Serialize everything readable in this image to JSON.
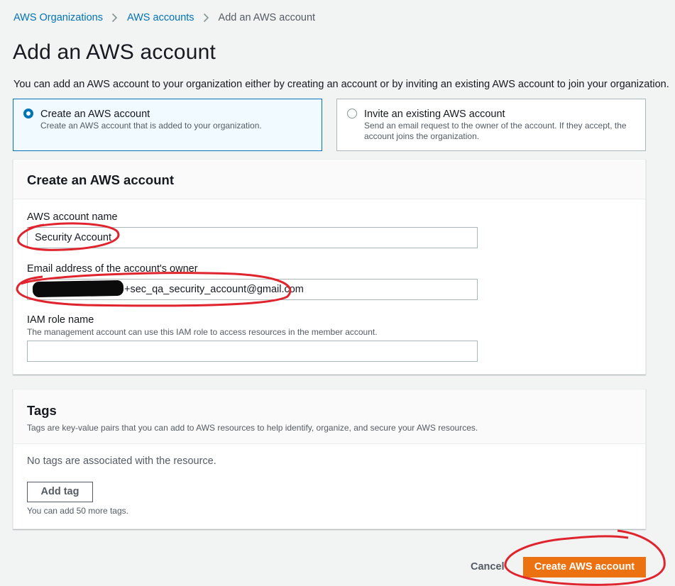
{
  "breadcrumb": {
    "items": [
      "AWS Organizations",
      "AWS accounts",
      "Add an AWS account"
    ]
  },
  "page": {
    "title": "Add an AWS account",
    "intro": "You can add an AWS account to your organization either by creating an account or by inviting an existing AWS account to join your organization."
  },
  "options": {
    "create": {
      "title": "Create an AWS account",
      "desc": "Create an AWS account that is added to your organization.",
      "selected": true
    },
    "invite": {
      "title": "Invite an existing AWS account",
      "desc": "Send an email request to the owner of the account. If they accept, the account joins the organization.",
      "selected": false
    }
  },
  "form": {
    "heading": "Create an AWS account",
    "account_name": {
      "label": "AWS account name",
      "value": "Security Account"
    },
    "email": {
      "label": "Email address of the account's owner",
      "value": "+sec_qa_security_account@gmail.com"
    },
    "iam_role": {
      "label": "IAM role name",
      "desc": "The management account can use this IAM role to access resources in the member account.",
      "value": ""
    }
  },
  "tags": {
    "heading": "Tags",
    "desc": "Tags are key-value pairs that you can add to AWS resources to help identify, organize, and secure your AWS resources.",
    "empty": "No tags are associated with the resource.",
    "add_label": "Add tag",
    "limit": "You can add 50 more tags."
  },
  "actions": {
    "cancel": "Cancel",
    "submit": "Create AWS account"
  },
  "colors": {
    "link": "#0073bb",
    "primary": "#ec7211",
    "annotation": "#e0242e"
  }
}
